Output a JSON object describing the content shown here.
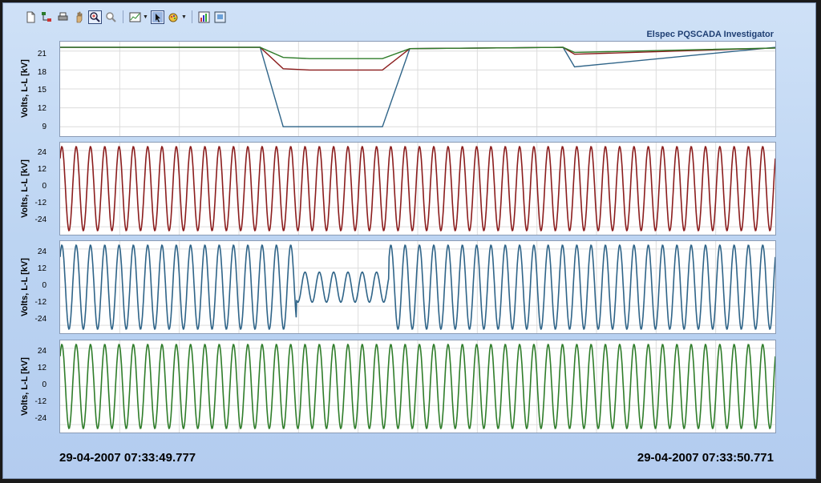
{
  "app": {
    "brand": "Elspec PQSCADA Investigator"
  },
  "toolbar": {
    "buttons": [
      {
        "icon": "new-document-icon"
      },
      {
        "icon": "tree-icon"
      },
      {
        "icon": "print-icon"
      },
      {
        "icon": "pan-hand-icon"
      },
      {
        "icon": "zoom-in-icon",
        "selected": true
      },
      {
        "icon": "zoom-out-icon"
      },
      {
        "icon": "chart-settings-icon"
      },
      {
        "icon": "cursor-select-icon",
        "selected": true
      },
      {
        "icon": "color-palette-icon"
      },
      {
        "icon": "report-icon"
      },
      {
        "icon": "export-icon"
      }
    ]
  },
  "colors": {
    "red": "#8b1d1d",
    "blue": "#2f6488",
    "green": "#2f7d2a"
  },
  "panels": [
    {
      "ylabel": "Volts, L-L [kV]",
      "ticks": [
        "21",
        "18",
        "15",
        "12",
        "9"
      ]
    },
    {
      "ylabel": "Volts, L-L [kV]",
      "ticks": [
        "24",
        "12",
        "0",
        "-12",
        "-24"
      ]
    },
    {
      "ylabel": "Volts, L-L [kV]",
      "ticks": [
        "24",
        "12",
        "0",
        "-12",
        "-24"
      ]
    },
    {
      "ylabel": "Volts, L-L [kV]",
      "ticks": [
        "24",
        "12",
        "0",
        "-12",
        "-24"
      ]
    }
  ],
  "time": {
    "start": "29-04-2007 07:33:49.777",
    "end": "29-04-2007 07:33:50.771"
  },
  "chart_data": [
    {
      "type": "line",
      "ylabel": "Volts, L-L [kV]",
      "ylim": [
        7.5,
        22.5
      ],
      "yticks": [
        21,
        18,
        15,
        12,
        9
      ],
      "x": [
        "07:33:49.777",
        "07:33:49.806",
        "07:33:49.852",
        "07:33:50.055",
        "07:33:50.087",
        "07:33:50.124",
        "07:33:50.225",
        "07:33:50.263",
        "07:33:50.476",
        "07:33:50.492",
        "07:33:50.771"
      ],
      "series": [
        {
          "values": [
            21.6,
            21.6,
            21.6,
            21.6,
            9.0,
            9.0,
            9.0,
            21.4,
            21.6,
            18.5,
            21.6
          ]
        },
        {
          "values": [
            21.6,
            21.6,
            21.6,
            21.6,
            18.2,
            18.0,
            18.0,
            21.4,
            21.6,
            20.5,
            21.5
          ]
        },
        {
          "values": [
            21.6,
            21.6,
            21.6,
            21.6,
            20.0,
            19.8,
            19.8,
            21.4,
            21.6,
            20.8,
            21.5
          ]
        }
      ],
      "grid": true
    },
    {
      "type": "line",
      "ylabel": "Volts, L-L [kV]",
      "ylim": [
        -29,
        29
      ],
      "yticks": [
        24,
        12,
        0,
        -12,
        -24
      ],
      "cycles": 50,
      "amplitude_kv": 26.5,
      "grid": true
    },
    {
      "type": "line",
      "ylabel": "Volts, L-L [kV]",
      "ylim": [
        -29,
        29
      ],
      "yticks": [
        24,
        12,
        0,
        -12,
        -24
      ],
      "cycles": 50,
      "amplitude_kv": 26.5,
      "sag_amplitude_kv": 9.5,
      "sag_from_cycle": 16.5,
      "sag_to_cycle": 23,
      "grid": true
    },
    {
      "type": "line",
      "ylabel": "Volts, L-L [kV]",
      "ylim": [
        -29,
        29
      ],
      "yticks": [
        24,
        12,
        0,
        -12,
        -24
      ],
      "cycles": 50,
      "amplitude_kv": 26.5,
      "grid": true
    }
  ]
}
